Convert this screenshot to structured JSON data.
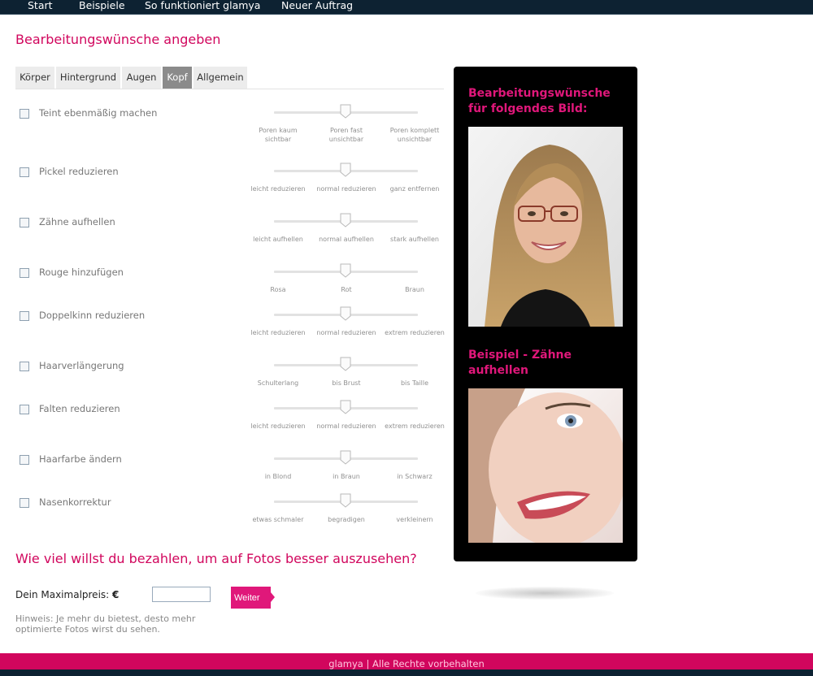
{
  "nav": {
    "items": [
      "Start",
      "Beispiele",
      "So funktioniert glamya",
      "Neuer Auftrag"
    ]
  },
  "page_title": "Bearbeitungswünsche angeben",
  "tabs": {
    "items": [
      "Körper",
      "Hintergrund",
      "Augen",
      "Kopf",
      "Allgemein"
    ],
    "active": "Kopf"
  },
  "options": [
    {
      "label": "Teint ebenmäßig machen",
      "checked": false,
      "slider": [
        "Poren kaum sichtbar",
        "Poren fast unsichtbar",
        "Poren komplett unsichtbar"
      ],
      "value": "Poren fast unsichtbar"
    },
    {
      "label": "Pickel reduzieren",
      "checked": false,
      "slider": [
        "leicht reduzieren",
        "normal reduzieren",
        "ganz entfernen"
      ],
      "value": "normal reduzieren"
    },
    {
      "label": "Zähne aufhellen",
      "checked": false,
      "slider": [
        "leicht aufhellen",
        "normal aufhellen",
        "stark aufhellen"
      ],
      "value": "normal aufhellen"
    },
    {
      "label": "Rouge hinzufügen",
      "checked": false,
      "slider": [
        "Rosa",
        "Rot",
        "Braun"
      ],
      "value": "Rot"
    },
    {
      "label": "Doppelkinn reduzieren",
      "checked": false,
      "slider": [
        "leicht reduzieren",
        "normal reduzieren",
        "extrem reduzieren"
      ],
      "value": "normal reduzieren"
    },
    {
      "label": "Haarverlängerung",
      "checked": false,
      "slider": [
        "Schulterlang",
        "bis Brust",
        "bis Taille"
      ],
      "value": "bis Brust"
    },
    {
      "label": "Falten reduzieren",
      "checked": false,
      "slider": [
        "leicht reduzieren",
        "normal reduzieren",
        "extrem reduzieren"
      ],
      "value": "normal reduzieren"
    },
    {
      "label": "Haarfarbe ändern",
      "checked": false,
      "slider": [
        "in Blond",
        "in Braun",
        "in Schwarz"
      ],
      "value": "in Braun"
    },
    {
      "label": "Nasenkorrektur",
      "checked": false,
      "slider": [
        "etwas schmaler",
        "begradigen",
        "verkleinern"
      ],
      "value": "begradigen"
    }
  ],
  "payment": {
    "question": "Wie viel willst du bezahlen, um auf Fotos besser auszusehen?",
    "label": "Dein Maximalpreis: ",
    "currency": "€",
    "input_value": "",
    "button": "Weiter",
    "hint": "Hinweis: Je mehr du bietest, desto mehr optimierte Fotos wirst du sehen."
  },
  "sidebar": {
    "heading1": "Bearbeitungswünsche für folgendes Bild:",
    "heading2": "Beispiel - Zähne aufhellen"
  },
  "footer": "glamya | Alle Rechte vorbehalten",
  "colors": {
    "brand_pink": "#d1065d",
    "button_pink": "#e0187a",
    "nav_bg": "#0d2232"
  }
}
